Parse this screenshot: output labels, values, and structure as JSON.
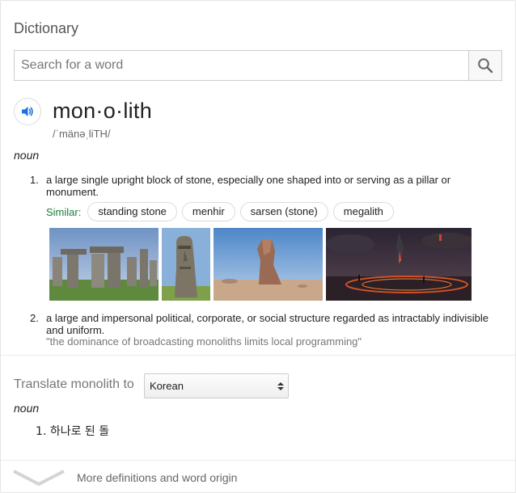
{
  "header": {
    "title": "Dictionary"
  },
  "search": {
    "placeholder": "Search for a word",
    "button_icon": "search-icon"
  },
  "entry": {
    "word": "mon·o·lith",
    "phonetic": "/ˈmänəˌliTH/",
    "pronounce_icon": "speaker-icon",
    "part_of_speech": "noun",
    "definitions": [
      {
        "number": "1.",
        "text": "a large single upright block of stone, especially one shaped into or serving as a pillar or monument.",
        "similar_label": "Similar:",
        "similar": [
          "standing stone",
          "menhir",
          "sarsen (stone)",
          "megalith"
        ]
      },
      {
        "number": "2.",
        "text": "a large and impersonal political, corporate, or social structure regarded as intractably indivisible and uniform.",
        "example": "\"the dominance of broadcasting monoliths limits local programming\""
      }
    ]
  },
  "translate": {
    "label": "Translate monolith to",
    "language": "Korean",
    "part_of_speech": "noun",
    "items": [
      {
        "number": "1.",
        "text": "하나로 된 돌"
      }
    ]
  },
  "footer": {
    "more_label": "More definitions and word origin",
    "expand_icon": "chevron-down-icon"
  },
  "colors": {
    "similar_label": "#188038",
    "speaker": "#1a73e8"
  }
}
